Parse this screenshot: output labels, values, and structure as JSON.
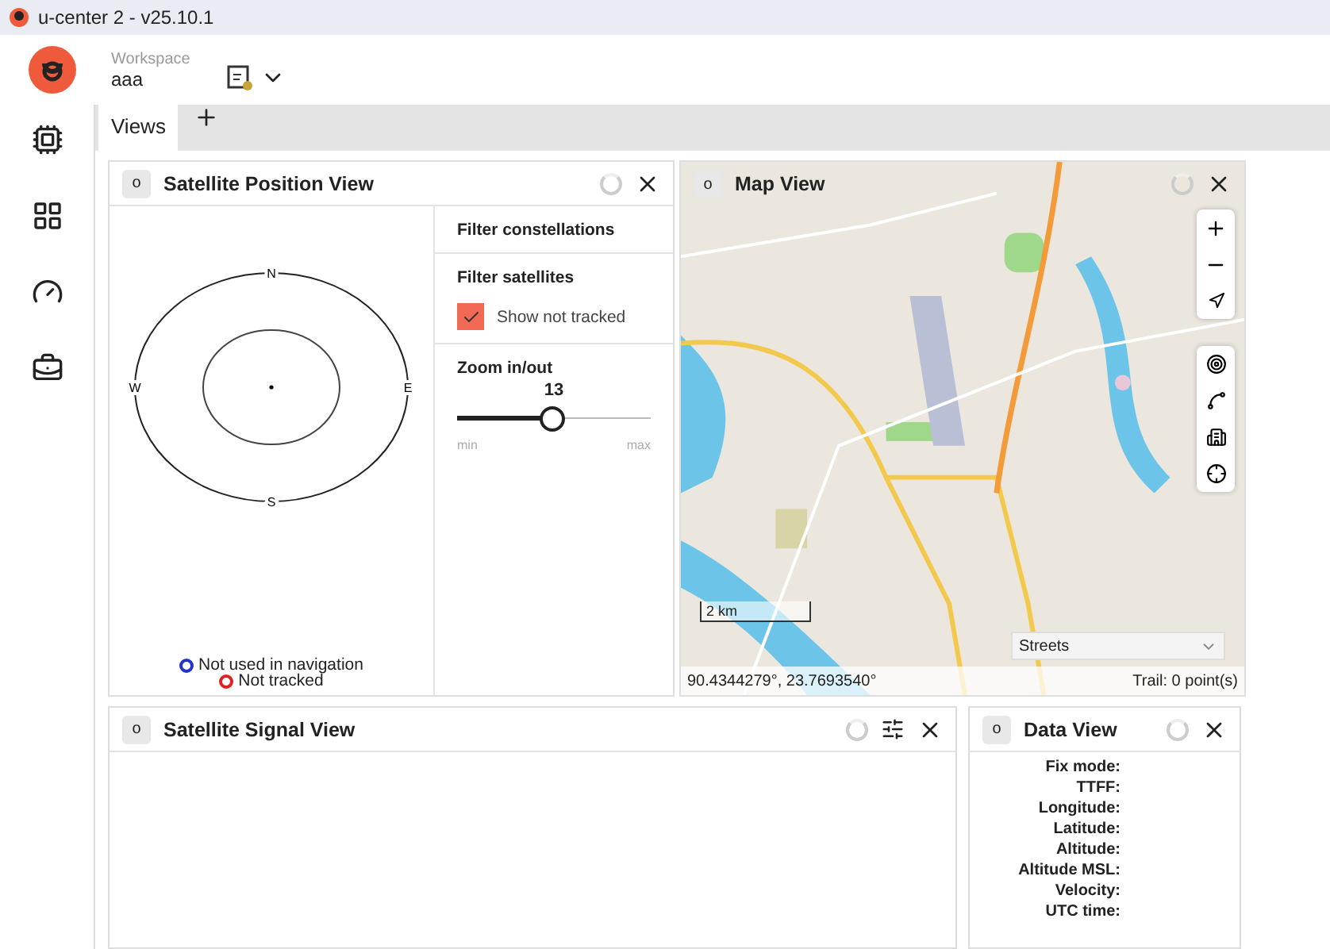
{
  "window": {
    "title": "u-center 2 - v25.10.1"
  },
  "workspace": {
    "label": "Workspace",
    "name": "aaa"
  },
  "tabs": [
    {
      "label": "Views",
      "selected": true
    }
  ],
  "position_view": {
    "badge": "o",
    "title": "Satellite Position View",
    "compass": {
      "n": "N",
      "e": "E",
      "s": "S",
      "w": "W"
    },
    "legend": [
      {
        "label": "Not used in navigation",
        "color": "#2233cc"
      },
      {
        "label": "Not tracked",
        "color": "#e02020"
      }
    ],
    "filters": [
      {
        "heading": "Filter constellations"
      },
      {
        "heading": "Filter satellites",
        "option": {
          "label": "Show not tracked",
          "checked": true
        }
      }
    ],
    "zoom": {
      "label": "Zoom in/out",
      "value": "13",
      "level": 0.49,
      "min": "min",
      "max": "max"
    }
  },
  "map_view": {
    "badge": "o",
    "title": "Map View",
    "scale": "2 km",
    "style": "Streets",
    "coordinates": "90.4344279°, 23.7693540°",
    "trail": "Trail: 0 point(s)"
  },
  "signal_view": {
    "badge": "o",
    "title": "Satellite Signal View"
  },
  "data_view": {
    "badge": "o",
    "title": "Data View",
    "fields": [
      "Fix mode:",
      "TTFF:",
      "Longitude:",
      "Latitude:",
      "Altitude:",
      "Altitude MSL:",
      "Velocity:",
      "UTC time:"
    ]
  }
}
